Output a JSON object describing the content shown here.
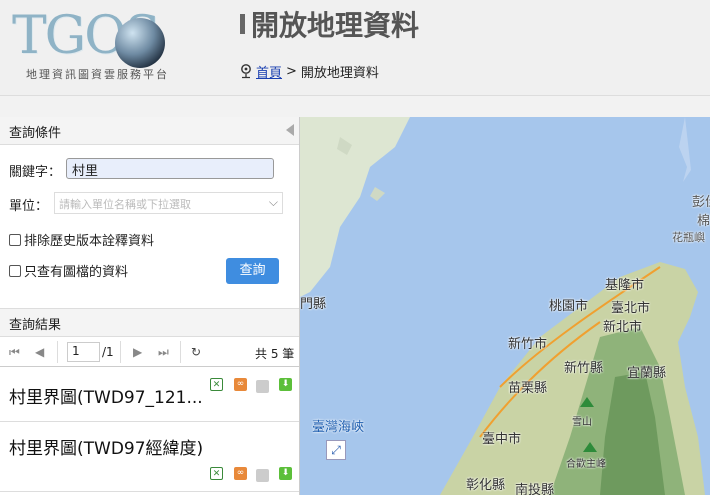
{
  "header": {
    "logo_text": "TGOS",
    "logo_subtitle": "地理資訊圖資雲服務平台",
    "title": "開放地理資料",
    "breadcrumb": {
      "home": "首頁",
      "separator": ">",
      "current": "開放地理資料"
    }
  },
  "query": {
    "title": "查詢條件",
    "keyword_label": "關鍵字：",
    "keyword_value": "村里",
    "unit_label": "單位：",
    "unit_placeholder": "請輸入單位名稱或下拉選取",
    "exclude_history": "排除歷史版本詮釋資料",
    "only_with_images": "只查有圖檔的資料",
    "submit": "查詢"
  },
  "results": {
    "title": "查詢結果",
    "page": "1",
    "page_total": "/1",
    "total": "共 5 筆",
    "items": [
      {
        "title": "村里界圖(TWD97_121..."
      },
      {
        "title": "村里界圖(TWD97經緯度)"
      }
    ]
  },
  "map": {
    "labels": [
      "基隆市",
      "桃園市",
      "臺北市",
      "新北市",
      "新竹市",
      "新竹縣",
      "宜蘭縣",
      "苗栗縣",
      "雪山",
      "臺中市",
      "合歡主峰",
      "彰化縣",
      "南投縣",
      "門縣",
      "臺灣海峽",
      "彭佳",
      "棉花",
      "花瓶嶼"
    ]
  },
  "colors": {
    "accent": "#3f8de0",
    "sea": "#a6c6ec",
    "link": "#1a3fb0"
  }
}
